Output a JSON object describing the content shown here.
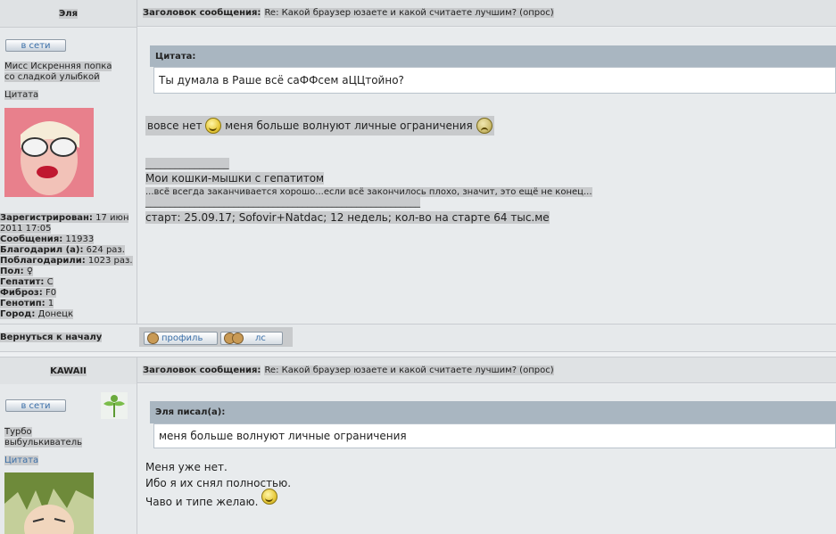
{
  "post1": {
    "author": "Эля",
    "subject_label": "Заголовок сообщения:",
    "subject": "Re: Какой браузер юзаете и какой считаете лучшим? (опрос)",
    "status_button": "в сети",
    "user_title_line1": "Мисс Искренняя попка",
    "user_title_line2": "со сладкой улыбкой",
    "quote_link": "Цитата",
    "quote": {
      "header": "Цитата:",
      "text": "Ты думала в Раше всё саФФсем аЦЦтойно?"
    },
    "message_before_smile": "вовсе нет",
    "message_after_smile": "меня больше волнуют личные ограничения",
    "signature": {
      "divider": "_________________",
      "line1": "Мои кошки-мышки с гепатитом",
      "line2": "...всё всегда заканчивается хорошо...если всё закончилось плохо, значит, это ещё не конец...",
      "divider2": "________________________________________________________",
      "line3": "старт: 25.09.17; Sofovir+Natdac; 12 недель; кол-во на старте 64 тыс.ме"
    },
    "stats": [
      {
        "label": "Зарегистрирован:",
        "value": "17 июн"
      },
      {
        "label": "",
        "value": "2011 17:05"
      },
      {
        "label": "Сообщения:",
        "value": "11933"
      },
      {
        "label": "Благодарил (а):",
        "value": "624 раз."
      },
      {
        "label": "Поблагодарили:",
        "value": "1023 раз."
      },
      {
        "label": "Пол:",
        "value": "♀"
      },
      {
        "label": "Гепатит:",
        "value": "C"
      },
      {
        "label": "Фиброз:",
        "value": "F0"
      },
      {
        "label": "Генотип:",
        "value": "1"
      },
      {
        "label": "Город:",
        "value": "Донецк"
      }
    ],
    "back_to_top": "Вернуться к началу",
    "profile_button": "профиль",
    "pm_button": "лс"
  },
  "post2": {
    "author": "KAWAII",
    "subject_label": "Заголовок сообщения:",
    "subject": "Re: Какой браузер юзаете и какой считаете лучшим? (опрос)",
    "status_button": "в сети",
    "user_title_line1": "Турбо",
    "user_title_line2": "выбулькиватель",
    "quote_link": "Цитата",
    "quote": {
      "header": "Эля писал(а):",
      "text": "меня больше волнуют личные ограничения"
    },
    "message_line1": "Меня уже нет.",
    "message_line2": "Ибо я их снял полностью.",
    "message_line3": "Чаво и типе желаю."
  },
  "colors": {
    "quote_header": "#a9b6c1",
    "status_text": "#3b6fa8",
    "highlight": "#c8cacc"
  }
}
